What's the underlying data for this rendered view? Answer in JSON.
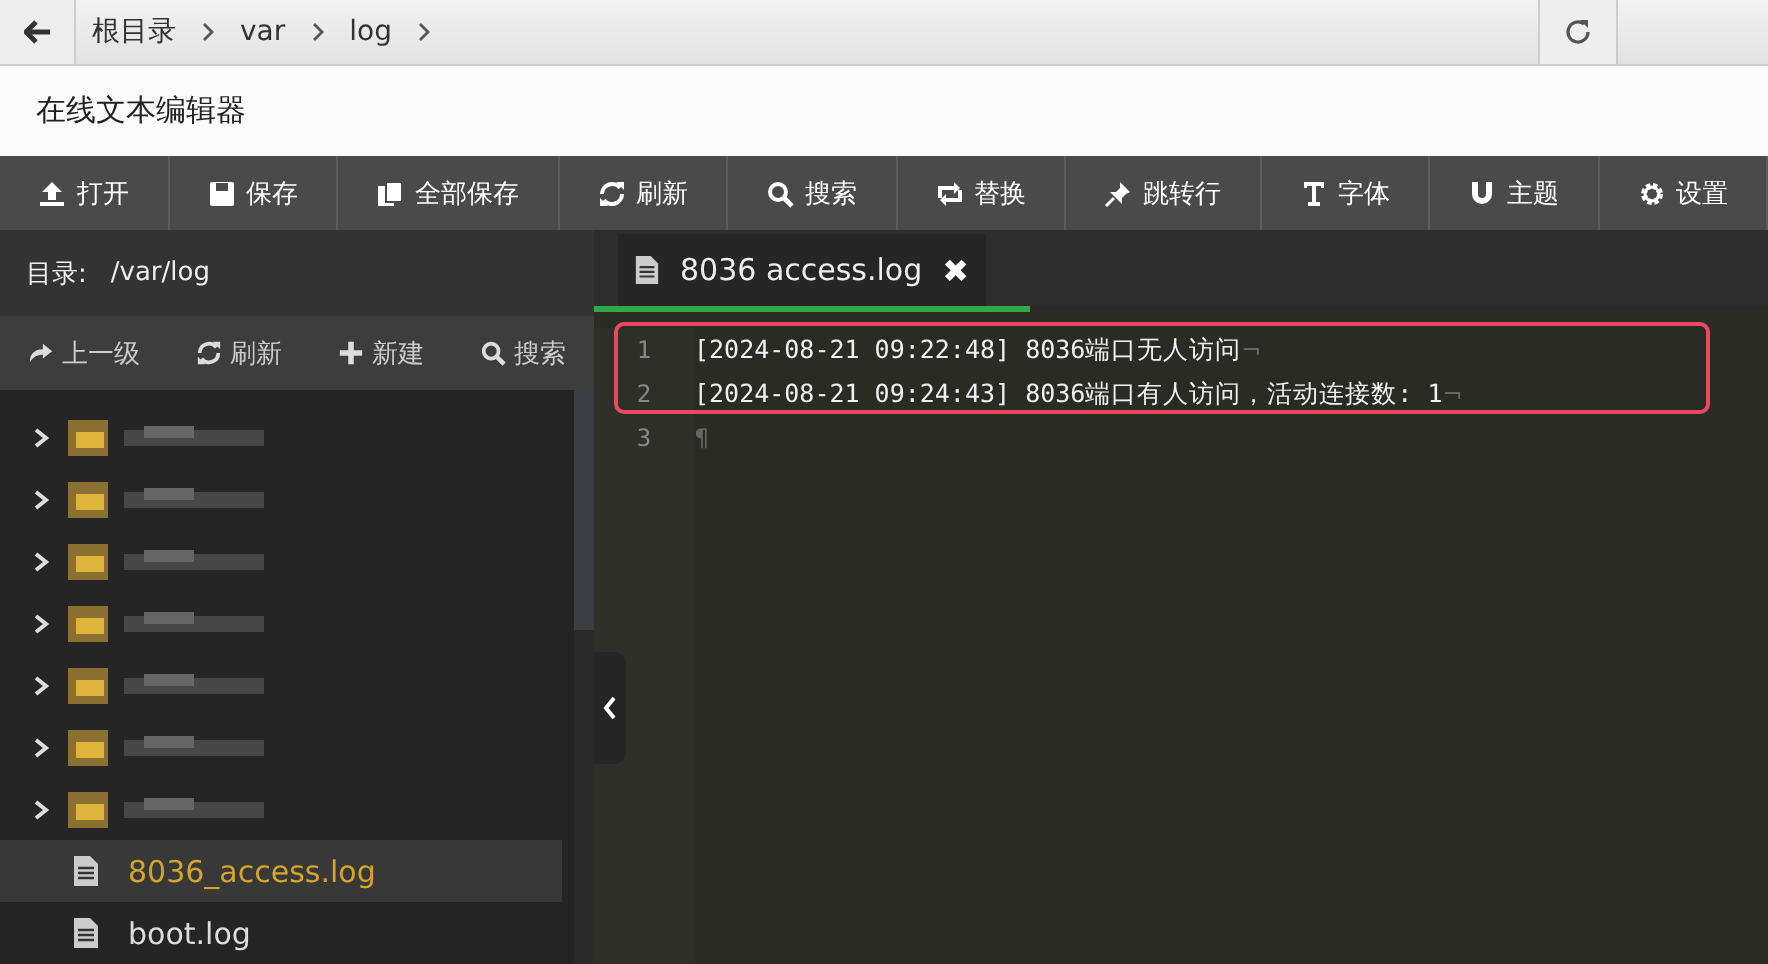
{
  "breadcrumb": [
    "根目录",
    "var",
    "log"
  ],
  "app_title": "在线文本编辑器",
  "toolbar": [
    {
      "kind": "upload",
      "label": "打开"
    },
    {
      "kind": "save",
      "label": "保存"
    },
    {
      "kind": "saveall",
      "label": "全部保存"
    },
    {
      "kind": "refresh",
      "label": "刷新"
    },
    {
      "kind": "search",
      "label": "搜索"
    },
    {
      "kind": "replace",
      "label": "替换"
    },
    {
      "kind": "pin",
      "label": "跳转行"
    },
    {
      "kind": "font",
      "label": "字体"
    },
    {
      "kind": "magnet",
      "label": "主题"
    },
    {
      "kind": "gear",
      "label": "设置"
    }
  ],
  "sidebar": {
    "dir_label": "目录:",
    "dir_path": "/var/log",
    "actions": [
      {
        "kind": "up",
        "label": "上一级"
      },
      {
        "kind": "refresh",
        "label": "刷新"
      },
      {
        "kind": "plus",
        "label": "新建"
      },
      {
        "kind": "search",
        "label": "搜索"
      }
    ],
    "items": [
      {
        "kind": "folder",
        "selected": false
      },
      {
        "kind": "folder",
        "selected": false
      },
      {
        "kind": "folder",
        "selected": false
      },
      {
        "kind": "folder",
        "selected": false
      },
      {
        "kind": "folder",
        "selected": false
      },
      {
        "kind": "folder",
        "selected": false
      },
      {
        "kind": "folder",
        "selected": false
      },
      {
        "kind": "file",
        "name": "8036_access.log",
        "selected": true
      },
      {
        "kind": "file",
        "name": "boot.log",
        "selected": false
      }
    ]
  },
  "editor": {
    "tab": {
      "title": "8036 access.log",
      "close": "✖"
    },
    "lines": [
      {
        "number": "1",
        "text": "[2024-08-21 09:22:48] 8036端口无人访问",
        "eol": "¬"
      },
      {
        "number": "2",
        "text": "[2024-08-21 09:24:43] 8036端口有人访问，活动连接数: 1",
        "eol": "¬"
      },
      {
        "number": "3",
        "eol": "¶"
      }
    ],
    "highlight_frame": true
  }
}
